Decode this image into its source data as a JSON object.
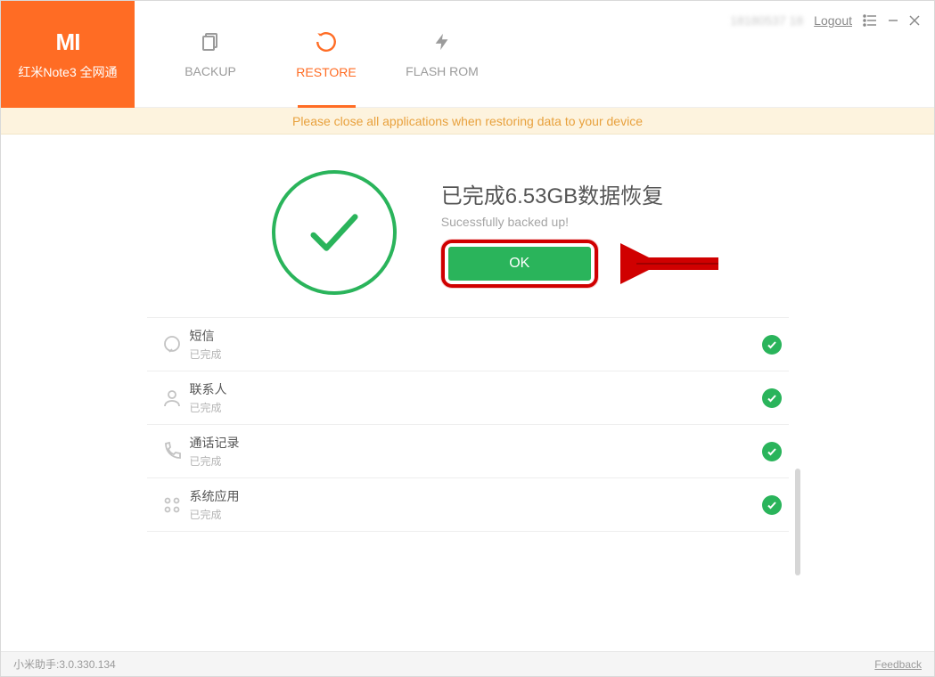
{
  "device": {
    "name": "红米Note3 全网通"
  },
  "nav": {
    "backup": "BACKUP",
    "restore": "RESTORE",
    "flash": "FLASH ROM"
  },
  "header": {
    "user_id": "18180537 18",
    "logout": "Logout"
  },
  "banner": {
    "text": "Please close all applications when restoring data to your device"
  },
  "result": {
    "title": "已完成6.53GB数据恢复",
    "subtitle": "Sucessfully backed up!",
    "ok_label": "OK"
  },
  "items": [
    {
      "title": "短信",
      "status": "已完成",
      "icon": "chat"
    },
    {
      "title": "联系人",
      "status": "已完成",
      "icon": "person"
    },
    {
      "title": "通话记录",
      "status": "已完成",
      "icon": "phone"
    },
    {
      "title": "系统应用",
      "status": "已完成",
      "icon": "apps"
    }
  ],
  "statusbar": {
    "version": "小米助手:3.0.330.134",
    "feedback": "Feedback"
  }
}
